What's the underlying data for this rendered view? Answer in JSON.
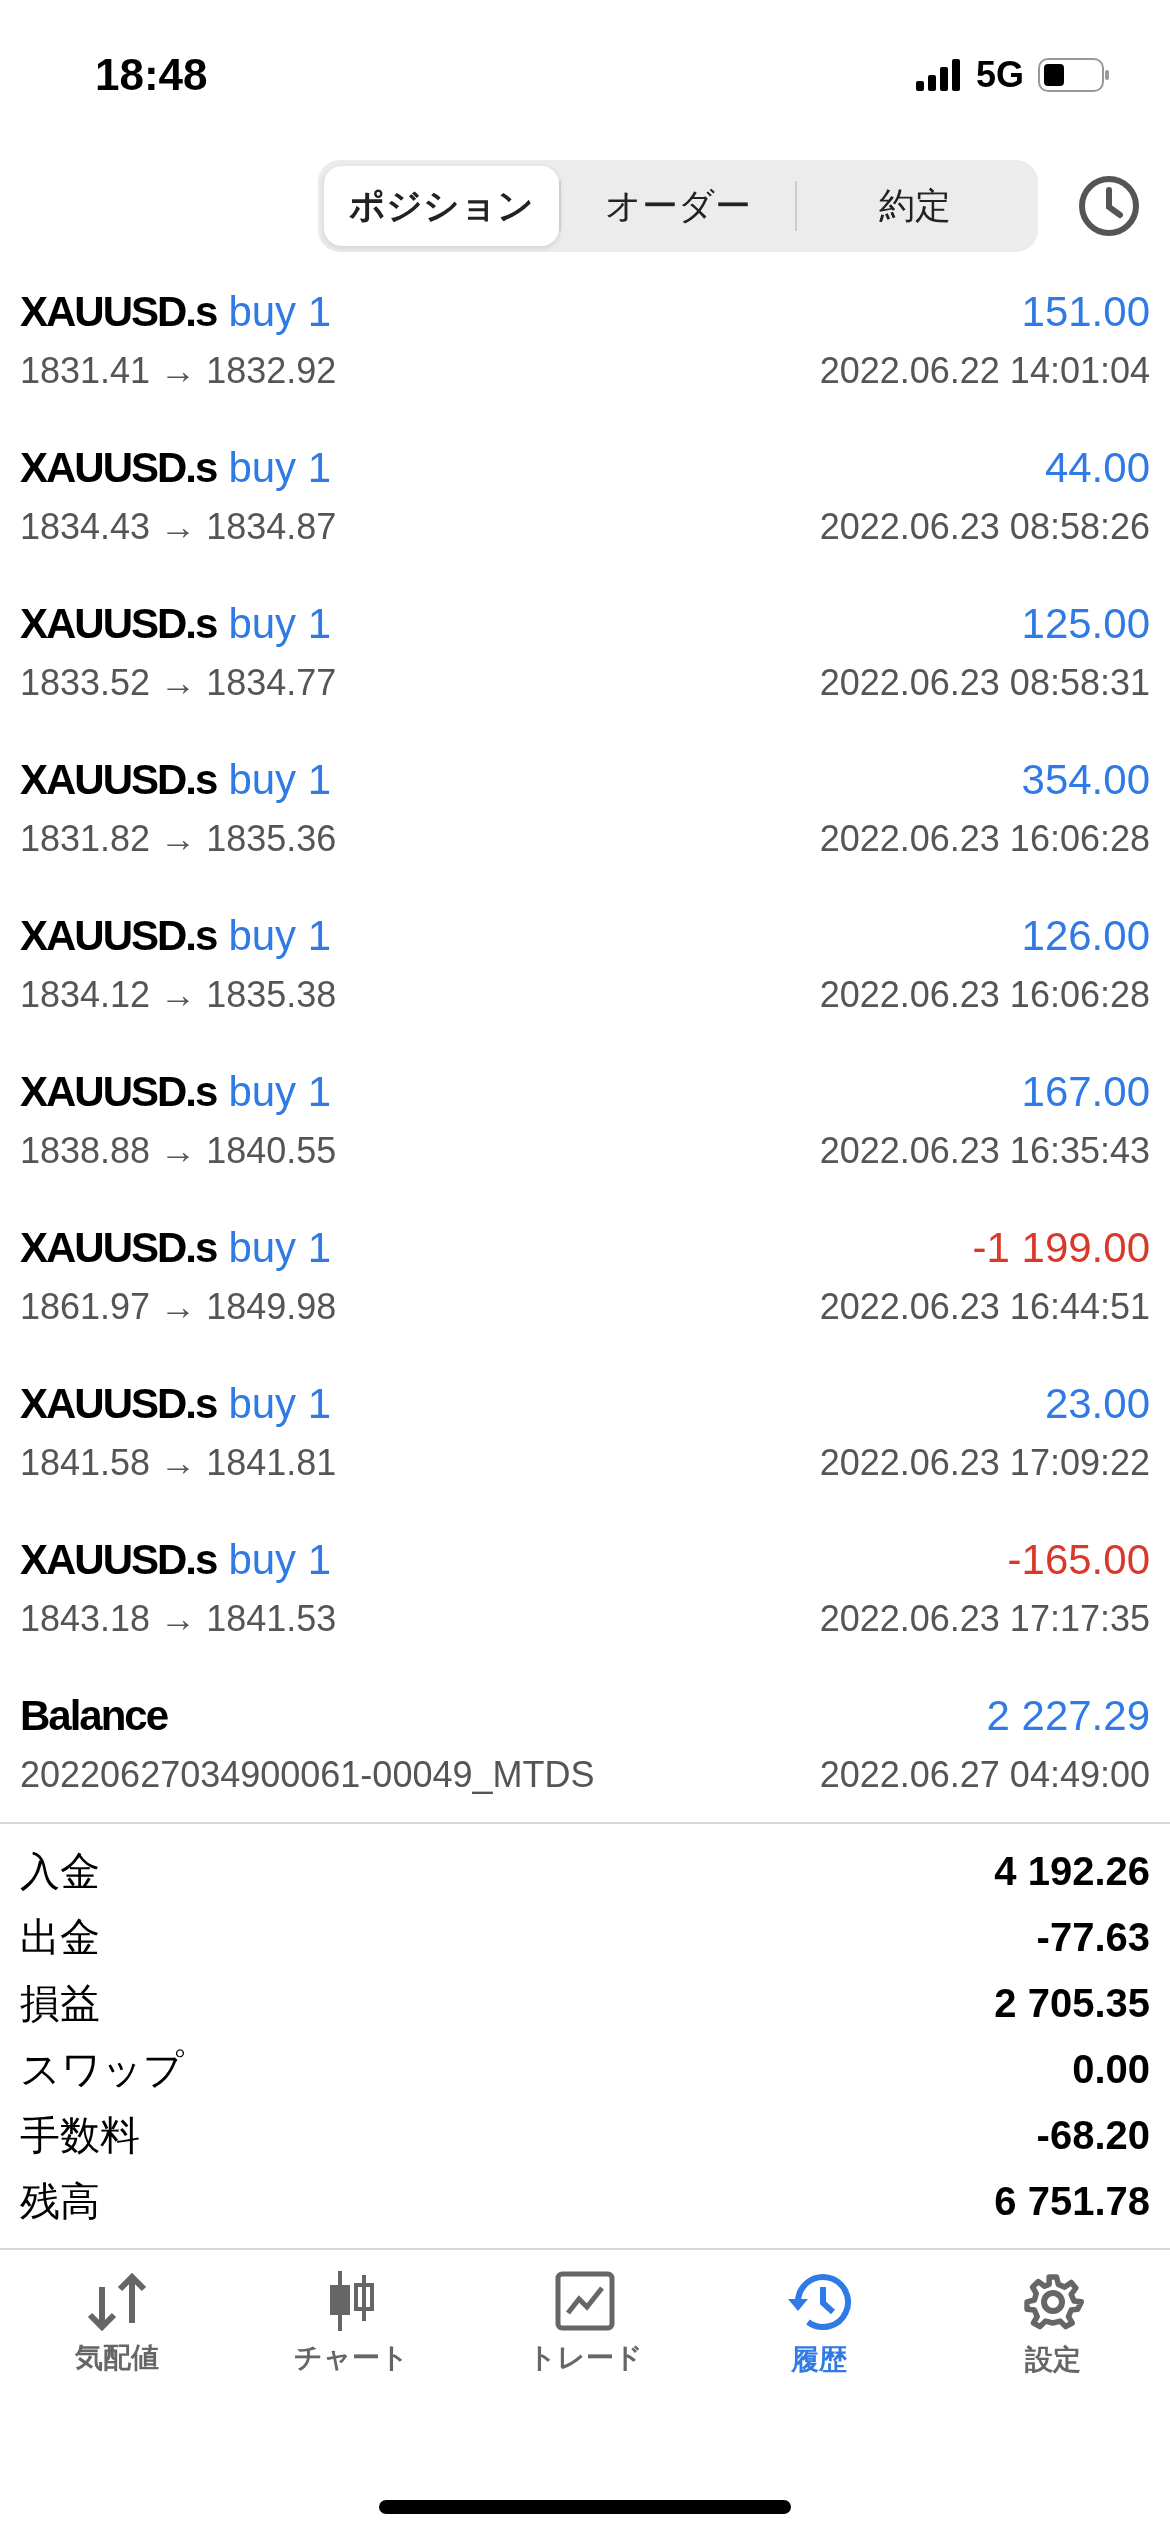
{
  "status_bar": {
    "time": "18:48",
    "network": "5G"
  },
  "tabs": [
    {
      "label": "ポジション",
      "selected": true
    },
    {
      "label": "オーダー",
      "selected": false
    },
    {
      "label": "約定",
      "selected": false
    }
  ],
  "deals": [
    {
      "symbol": "XAUUSD.s",
      "action": "buy 1",
      "prices": "1831.41 → 1832.92",
      "profit": "151.00",
      "negative": false,
      "time": "2022.06.22 14:01:04"
    },
    {
      "symbol": "XAUUSD.s",
      "action": "buy 1",
      "prices": "1834.43 → 1834.87",
      "profit": "44.00",
      "negative": false,
      "time": "2022.06.23 08:58:26"
    },
    {
      "symbol": "XAUUSD.s",
      "action": "buy 1",
      "prices": "1833.52 → 1834.77",
      "profit": "125.00",
      "negative": false,
      "time": "2022.06.23 08:58:31"
    },
    {
      "symbol": "XAUUSD.s",
      "action": "buy 1",
      "prices": "1831.82 → 1835.36",
      "profit": "354.00",
      "negative": false,
      "time": "2022.06.23 16:06:28"
    },
    {
      "symbol": "XAUUSD.s",
      "action": "buy 1",
      "prices": "1834.12 → 1835.38",
      "profit": "126.00",
      "negative": false,
      "time": "2022.06.23 16:06:28"
    },
    {
      "symbol": "XAUUSD.s",
      "action": "buy 1",
      "prices": "1838.88 → 1840.55",
      "profit": "167.00",
      "negative": false,
      "time": "2022.06.23 16:35:43"
    },
    {
      "symbol": "XAUUSD.s",
      "action": "buy 1",
      "prices": "1861.97 → 1849.98",
      "profit": "-1 199.00",
      "negative": true,
      "time": "2022.06.23 16:44:51"
    },
    {
      "symbol": "XAUUSD.s",
      "action": "buy 1",
      "prices": "1841.58 → 1841.81",
      "profit": "23.00",
      "negative": false,
      "time": "2022.06.23 17:09:22"
    },
    {
      "symbol": "XAUUSD.s",
      "action": "buy 1",
      "prices": "1843.18 → 1841.53",
      "profit": "-165.00",
      "negative": true,
      "time": "2022.06.23 17:17:35"
    },
    {
      "symbol": "Balance",
      "prices": "20220627034900061-00049_MTDS",
      "profit": "2 227.29",
      "negative": false,
      "time": "2022.06.27 04:49:00"
    }
  ],
  "summary": [
    {
      "label": "入金",
      "value": "4 192.26"
    },
    {
      "label": "出金",
      "value": "-77.63"
    },
    {
      "label": "損益",
      "value": "2 705.35"
    },
    {
      "label": "スワップ",
      "value": "0.00"
    },
    {
      "label": "手数料",
      "value": "-68.20"
    },
    {
      "label": "残高",
      "value": "6 751.78"
    }
  ],
  "nav": [
    {
      "label": "気配値",
      "kind": "quotes",
      "selected": false
    },
    {
      "label": "チャート",
      "kind": "chart",
      "selected": false
    },
    {
      "label": "トレード",
      "kind": "trade",
      "selected": false
    },
    {
      "label": "履歴",
      "kind": "history",
      "selected": true
    },
    {
      "label": "設定",
      "kind": "settings",
      "selected": false
    }
  ]
}
